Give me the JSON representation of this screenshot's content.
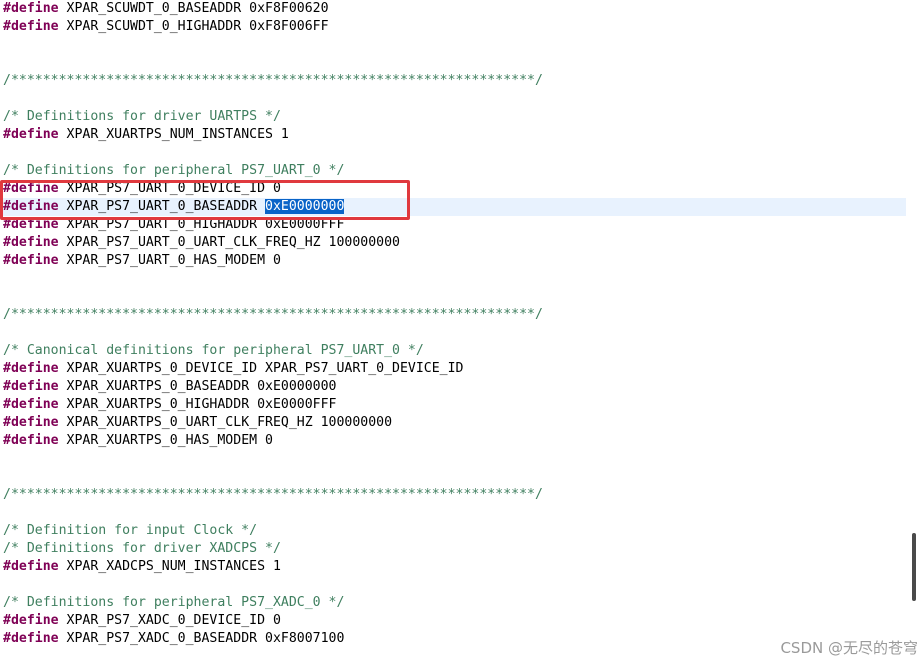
{
  "editor": {
    "lines": [
      {
        "kw": "#define",
        "text": " XPAR_SCUWDT_0_BASEADDR 0xF8F00620"
      },
      {
        "kw": "#define",
        "text": " XPAR_SCUWDT_0_HIGHADDR 0xF8F006FF"
      },
      {
        "comment": "/******************************************************************/"
      },
      {
        "comment": "/* Definitions for driver UARTPS */"
      },
      {
        "kw": "#define",
        "text": " XPAR_XUARTPS_NUM_INSTANCES 1"
      },
      {
        "comment": "/* Definitions for peripheral PS7_UART_0 */"
      },
      {
        "kw": "#define",
        "text": " XPAR_PS7_UART_0_DEVICE_ID 0"
      },
      {
        "kw": "#define",
        "text": " XPAR_PS7_UART_0_BASEADDR ",
        "selected": "0xE0000000"
      },
      {
        "kw": "#define",
        "text": " XPAR_PS7_UART_0_HIGHADDR 0xE0000FFF"
      },
      {
        "kw": "#define",
        "text": " XPAR_PS7_UART_0_UART_CLK_FREQ_HZ 100000000"
      },
      {
        "kw": "#define",
        "text": " XPAR_PS7_UART_0_HAS_MODEM 0"
      },
      {
        "comment": "/******************************************************************/"
      },
      {
        "comment": "/* Canonical definitions for peripheral PS7_UART_0 */"
      },
      {
        "kw": "#define",
        "text": " XPAR_XUARTPS_0_DEVICE_ID XPAR_PS7_UART_0_DEVICE_ID"
      },
      {
        "kw": "#define",
        "text": " XPAR_XUARTPS_0_BASEADDR 0xE0000000"
      },
      {
        "kw": "#define",
        "text": " XPAR_XUARTPS_0_HIGHADDR 0xE0000FFF"
      },
      {
        "kw": "#define",
        "text": " XPAR_XUARTPS_0_UART_CLK_FREQ_HZ 100000000"
      },
      {
        "kw": "#define",
        "text": " XPAR_XUARTPS_0_HAS_MODEM 0"
      },
      {
        "comment": "/******************************************************************/"
      },
      {
        "comment": "/* Definition for input Clock */"
      },
      {
        "comment": "/* Definitions for driver XADCPS */"
      },
      {
        "kw": "#define",
        "text": " XPAR_XADCPS_NUM_INSTANCES 1"
      },
      {
        "comment": "/* Definitions for peripheral PS7_XADC_0 */"
      },
      {
        "kw": "#define",
        "text": " XPAR_PS7_XADC_0_DEVICE_ID 0"
      },
      {
        "kw": "#define",
        "text": " XPAR_PS7_XADC_0_BASEADDR 0xF8007100"
      }
    ]
  },
  "watermark": "CSDN @无尽的苍穹",
  "colors": {
    "keyword": "#7f0055",
    "comment": "#3f7f5f",
    "selection": "#0a64c8",
    "highlight_box": "#e0393e"
  }
}
